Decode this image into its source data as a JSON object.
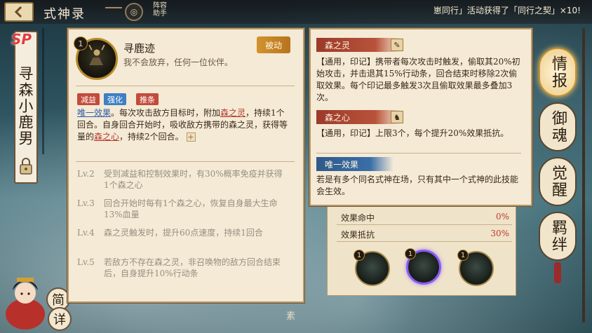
{
  "header": {
    "title": "式神录",
    "helper_label": "阵容助手",
    "notice": "崽同行」活动获得了「同行之契」×10!"
  },
  "shikigami": {
    "rarity": "SP",
    "name": "寻森小鹿男"
  },
  "buttons": {
    "simple": "简",
    "detail": "详"
  },
  "skill": {
    "level_badge": "1",
    "name": "寻鹿迹",
    "motto": "我不会放弃，任何一位伙伴。",
    "type_tag": "被动",
    "tags": [
      "减益",
      "强化",
      "推条"
    ],
    "desc_unique": "唯一效果",
    "desc_1": "。每次攻击敌方目标时，附加",
    "desc_forest_spirit": "森之灵",
    "desc_2": "，持续1个回合。自身回合开始时，吸收敌方携带的森之灵，获得等量的",
    "desc_forest_heart": "森之心",
    "desc_3": "，持续2个回合。",
    "levels": [
      {
        "label": "Lv.2",
        "text": "受到减益和控制效果时，有30%概率免疫并获得1个森之心"
      },
      {
        "label": "Lv.3",
        "text": "回合开始时每有1个森之心，恢复自身最大生命13%血量"
      },
      {
        "label": "Lv.4",
        "text": "森之灵触发时，提升60点速度，持续1回合"
      },
      {
        "label": "Lv.5",
        "text": "若敌方不存在森之灵，非召唤物的敌方回合结束后，自身提升10%行动条"
      }
    ]
  },
  "info": {
    "forest_spirit_title": "森之灵",
    "forest_spirit_text": "【通用，印记】携带者每次攻击时触发，偷取其20%初始攻击，并击退其15%行动条，回合结束时移除2次偷取效果。每个印记最多触发3次且偷取效果最多叠加3次。",
    "forest_heart_title": "森之心",
    "forest_heart_text": "【通用，印记】上限3个，每个提升20%效果抵抗。",
    "unique_title": "唯一效果",
    "unique_text": "若是有多个同名式神在场，只有其中一个式神的此技能会生效。"
  },
  "stats": [
    {
      "label": "效果命中",
      "value": "0%"
    },
    {
      "label": "效果抵抗",
      "value": "30%"
    }
  ],
  "skill_slots": [
    "1",
    "1",
    "1"
  ],
  "side_nav": [
    "情报",
    "御魂",
    "觉醒",
    "羁绊"
  ],
  "bottom_label": "素",
  "colors": {
    "panel_bg": "#f4ead6",
    "accent_gold": "#b88a2a",
    "tag_red": "#c24b3b",
    "tag_blue": "#3f7fc4",
    "stat_red": "#c0392b"
  }
}
